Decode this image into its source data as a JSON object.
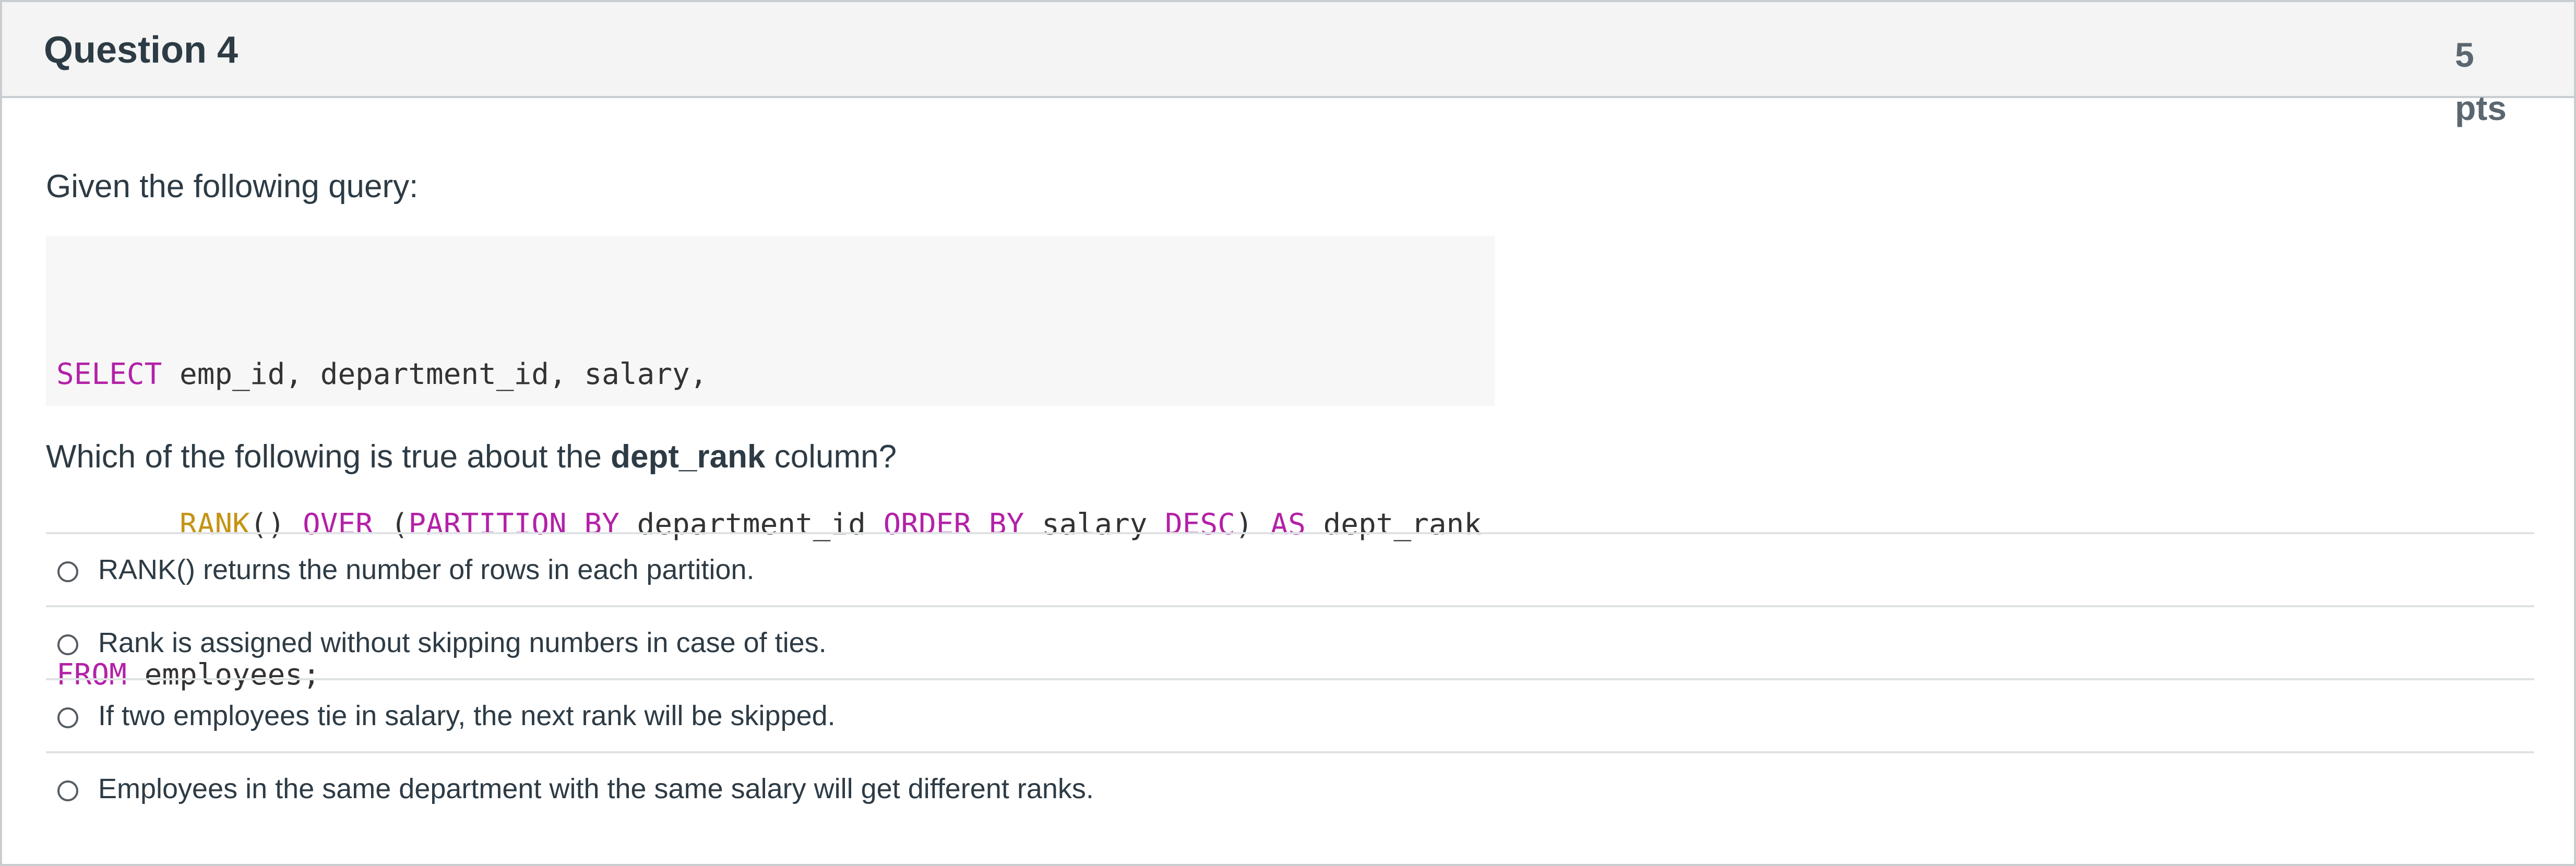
{
  "question": {
    "title": "Question 4",
    "points_value": "5",
    "points_unit": "pts",
    "intro": "Given the following query:",
    "code": {
      "line1": [
        {
          "t": "SELECT",
          "c": "kw"
        },
        {
          "t": " emp_id, department_id, salary,",
          "c": ""
        }
      ],
      "line2": [
        {
          "t": "       ",
          "c": ""
        },
        {
          "t": "RANK",
          "c": "fn"
        },
        {
          "t": "() ",
          "c": ""
        },
        {
          "t": "OVER",
          "c": "kw"
        },
        {
          "t": " (",
          "c": ""
        },
        {
          "t": "PARTITION BY",
          "c": "kw"
        },
        {
          "t": " department_id ",
          "c": ""
        },
        {
          "t": "ORDER BY",
          "c": "kw"
        },
        {
          "t": " salary ",
          "c": ""
        },
        {
          "t": "DESC",
          "c": "kw"
        },
        {
          "t": ") ",
          "c": ""
        },
        {
          "t": "AS",
          "c": "kw"
        },
        {
          "t": " dept_rank",
          "c": ""
        }
      ],
      "line3": [
        {
          "t": "FROM",
          "c": "kw"
        },
        {
          "t": " employees;",
          "c": ""
        }
      ]
    },
    "prompt_before": "Which of the following is true about the ",
    "prompt_bold": "dept_rank",
    "prompt_after": " column?",
    "answers": [
      "RANK() returns the number of rows in each partition.",
      "Rank is assigned without skipping numbers in case of ties.",
      "If two employees tie in salary, the next rank will be skipped.",
      "Employees in the same department with the same salary will get different ranks."
    ]
  },
  "colors": {
    "keyword": "#b321a7",
    "function": "#c49414",
    "text": "#2d3b45",
    "header_bg": "#f3f4f3"
  }
}
